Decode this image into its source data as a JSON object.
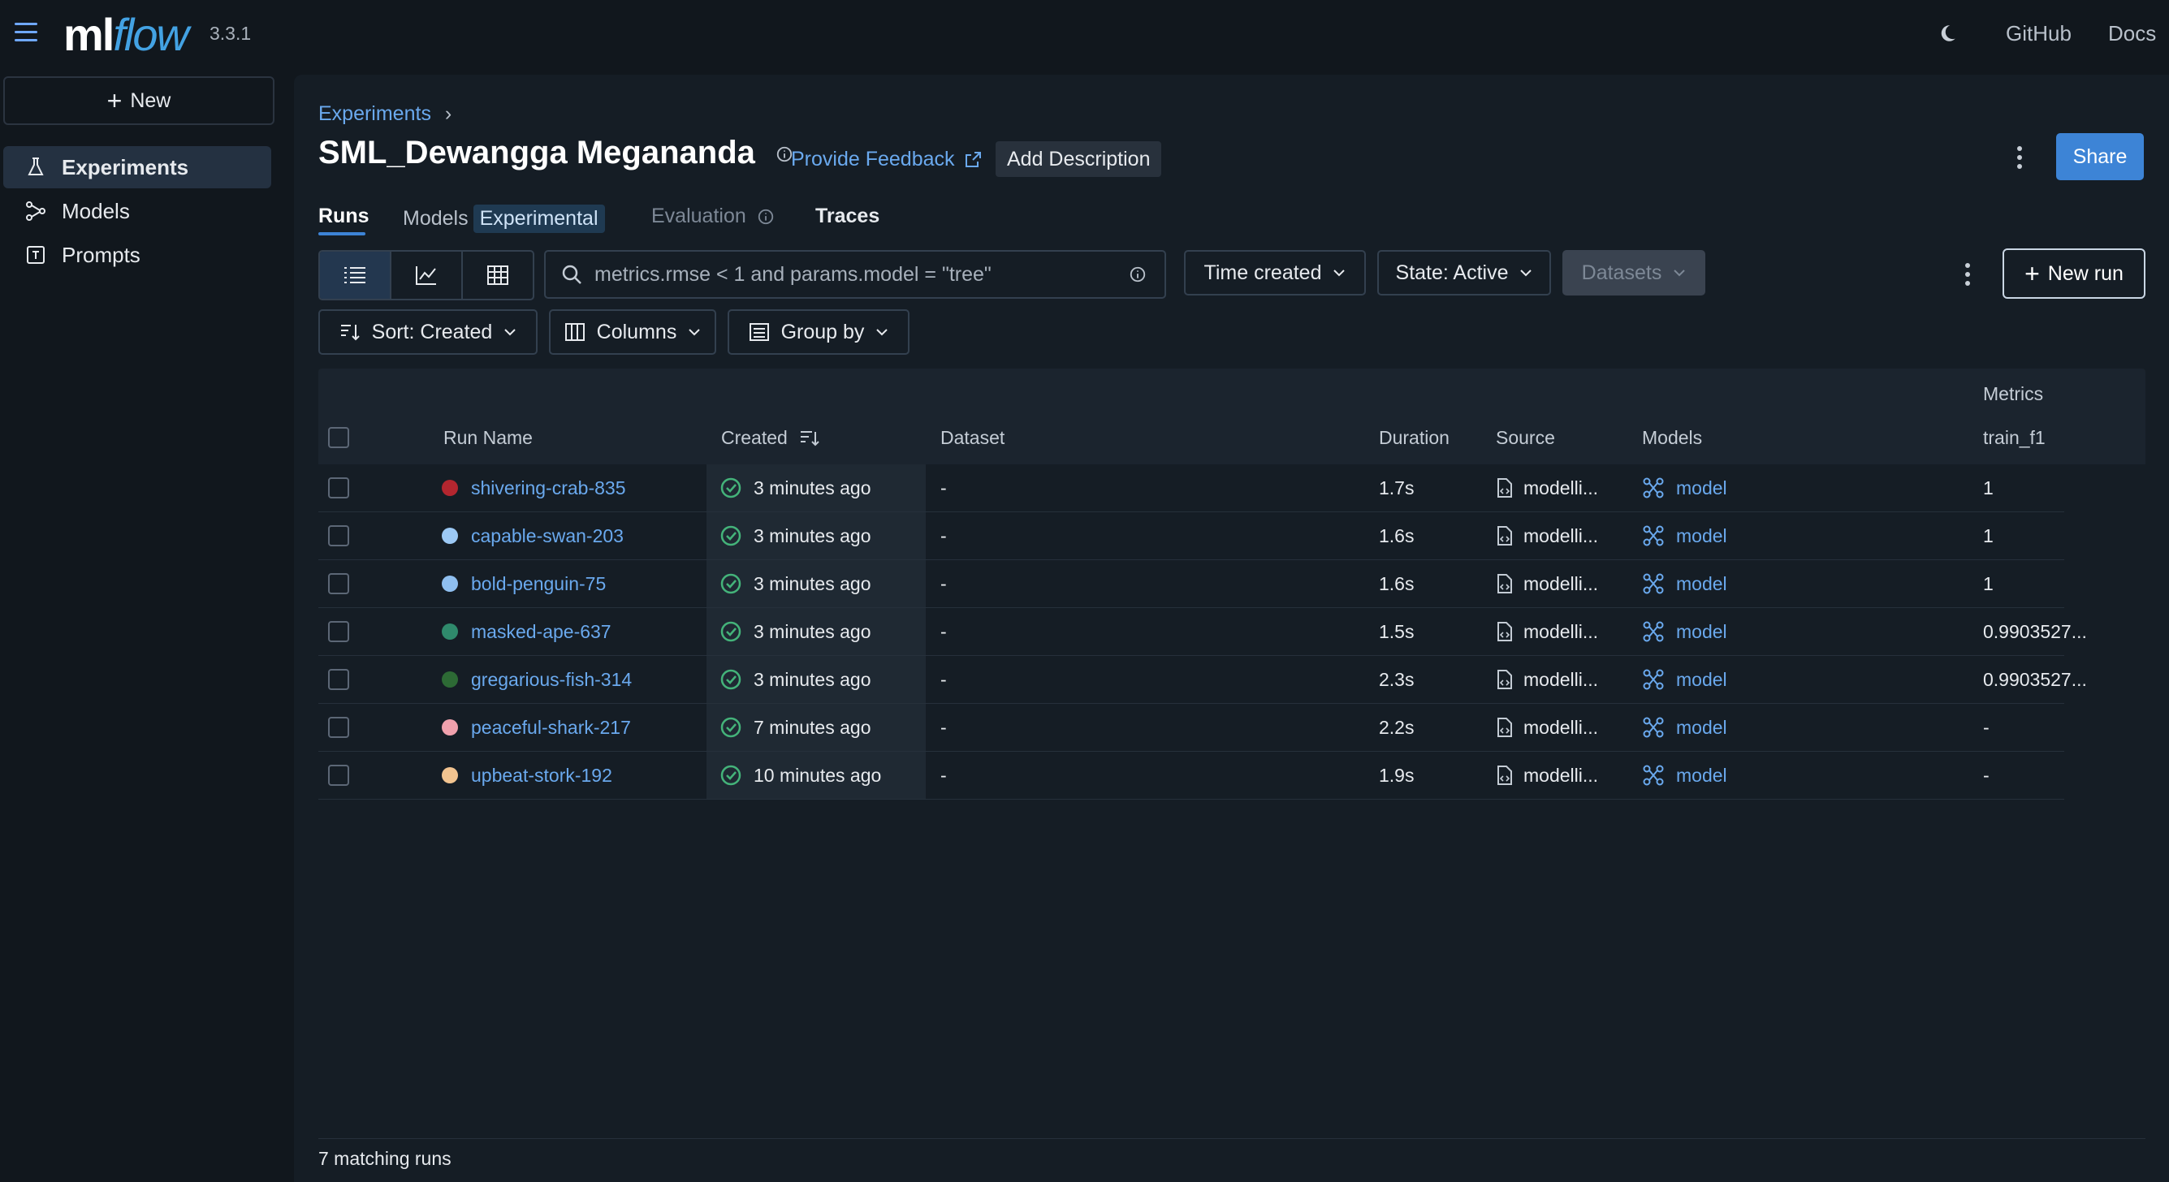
{
  "app": {
    "logo_ml": "ml",
    "logo_flow": "flow",
    "version": "3.3.1"
  },
  "topnav": {
    "github": "GitHub",
    "docs": "Docs"
  },
  "sidebar": {
    "new_label": "New",
    "items": [
      {
        "label": "Experiments",
        "icon": "flask-icon"
      },
      {
        "label": "Models",
        "icon": "models-icon"
      },
      {
        "label": "Prompts",
        "icon": "prompts-icon"
      }
    ]
  },
  "header": {
    "breadcrumb": "Experiments",
    "title": "SML_Dewangga Megananda",
    "feedback": "Provide Feedback",
    "add_description": "Add Description",
    "share": "Share"
  },
  "tabs": {
    "runs": "Runs",
    "models": "Models",
    "models_badge": "Experimental",
    "evaluation": "Evaluation",
    "traces": "Traces"
  },
  "toolbar": {
    "search_placeholder": "metrics.rmse < 1 and params.model = \"tree\"",
    "time_created": "Time created",
    "state": "State: Active",
    "datasets": "Datasets",
    "new_run": "New run",
    "sort": "Sort: Created",
    "columns": "Columns",
    "group_by": "Group by"
  },
  "table": {
    "group_header": "Metrics",
    "headers": {
      "run_name": "Run Name",
      "created": "Created",
      "dataset": "Dataset",
      "duration": "Duration",
      "source": "Source",
      "models": "Models",
      "train_f1": "train_f1"
    },
    "rows": [
      {
        "name": "shivering-crab-835",
        "color": "#b3262f",
        "created": "3 minutes ago",
        "dataset": "-",
        "duration": "1.7s",
        "source": "modelli...",
        "model": "model",
        "train_f1": "1"
      },
      {
        "name": "capable-swan-203",
        "color": "#9cc9f5",
        "created": "3 minutes ago",
        "dataset": "-",
        "duration": "1.6s",
        "source": "modelli...",
        "model": "model",
        "train_f1": "1"
      },
      {
        "name": "bold-penguin-75",
        "color": "#8fbff0",
        "created": "3 minutes ago",
        "dataset": "-",
        "duration": "1.6s",
        "source": "modelli...",
        "model": "model",
        "train_f1": "1"
      },
      {
        "name": "masked-ape-637",
        "color": "#2f8a6c",
        "created": "3 minutes ago",
        "dataset": "-",
        "duration": "1.5s",
        "source": "modelli...",
        "model": "model",
        "train_f1": "0.9903527..."
      },
      {
        "name": "gregarious-fish-314",
        "color": "#2d6a35",
        "created": "3 minutes ago",
        "dataset": "-",
        "duration": "2.3s",
        "source": "modelli...",
        "model": "model",
        "train_f1": "0.9903527..."
      },
      {
        "name": "peaceful-shark-217",
        "color": "#f0a1ad",
        "created": "7 minutes ago",
        "dataset": "-",
        "duration": "2.2s",
        "source": "modelli...",
        "model": "model",
        "train_f1": "-"
      },
      {
        "name": "upbeat-stork-192",
        "color": "#f2c490",
        "created": "10 minutes ago",
        "dataset": "-",
        "duration": "1.9s",
        "source": "modelli...",
        "model": "model",
        "train_f1": "-"
      }
    ]
  },
  "footer": {
    "matching": "7 matching runs"
  }
}
